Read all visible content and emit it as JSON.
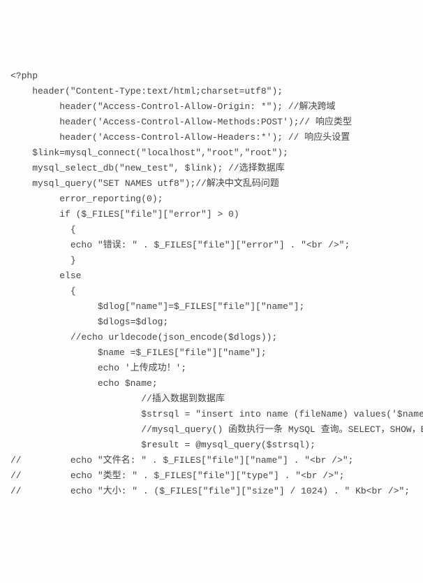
{
  "lines": [
    "<?php",
    "    header(\"Content-Type:text/html;charset=utf8\");",
    "         header(\"Access-Control-Allow-Origin: *\"); //解决跨域",
    "         header('Access-Control-Allow-Methods:POST');// 响应类型",
    "         header('Access-Control-Allow-Headers:*'); // 响应头设置",
    "    $link=mysql_connect(\"localhost\",\"root\",\"root\");",
    "    mysql_select_db(\"new_test\", $link); //选择数据库",
    "    mysql_query(\"SET NAMES utf8\");//解决中文乱码问题",
    "         error_reporting(0);",
    "         if ($_FILES[\"file\"][\"error\"] > 0)",
    "           {",
    "           echo \"错误: \" . $_FILES[\"file\"][\"error\"] . \"<br />\";",
    "           }",
    "         else",
    "           {",
    "                $dlog[\"name\"]=$_FILES[\"file\"][\"name\"];",
    "                $dlogs=$dlog;",
    "           //echo urldecode(json_encode($dlogs));",
    "                $name =$_FILES[\"file\"][\"name\"];",
    "                echo '上传成功！';",
    "                echo $name;",
    "                        //插入数据到数据库",
    "                        $strsql = \"insert into name (fileName) values('$name')\";",
    "                        //mysql_query() 函数执行一条 MySQL 查询。SELECT，SHOW，EXPLAIN",
    "                        $result = @mysql_query($strsql);",
    "//         echo \"文件名: \" . $_FILES[\"file\"][\"name\"] . \"<br />\";",
    "//         echo \"类型: \" . $_FILES[\"file\"][\"type\"] . \"<br />\";",
    "//         echo \"大小: \" . ($_FILES[\"file\"][\"size\"] / 1024) . \" Kb<br />\";"
  ]
}
